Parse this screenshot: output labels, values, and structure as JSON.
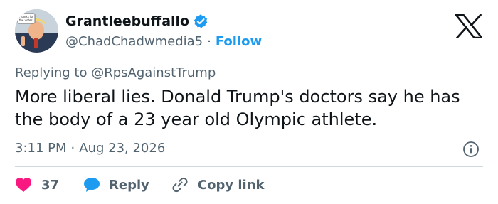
{
  "author": {
    "display_name": "Grantleebuffallo",
    "handle": "@ChadChadwmedia5",
    "separator": "·",
    "follow_label": "Follow",
    "avatar_sign_text": "Thanks for the votes!"
  },
  "reply_context": {
    "prefix": "Replying to",
    "mention": "@RpsAgainstTrump"
  },
  "tweet": {
    "text": "More liberal lies. Donald Trump's doctors say he has the body of a 23 year old Olympic athlete.",
    "time": "3:11 PM",
    "separator": "·",
    "date": "Aug 23, 2026"
  },
  "actions": {
    "like_count": "37",
    "reply_label": "Reply",
    "copy_link_label": "Copy link"
  },
  "colors": {
    "text": "#0f1419",
    "secondary": "#536471",
    "accent": "#1d9bf0",
    "like": "#f91880",
    "divider": "#cfd9de"
  },
  "icons": [
    "verified-badge-icon",
    "x-logo-icon",
    "info-icon",
    "heart-icon",
    "reply-bubble-icon",
    "link-icon"
  ]
}
